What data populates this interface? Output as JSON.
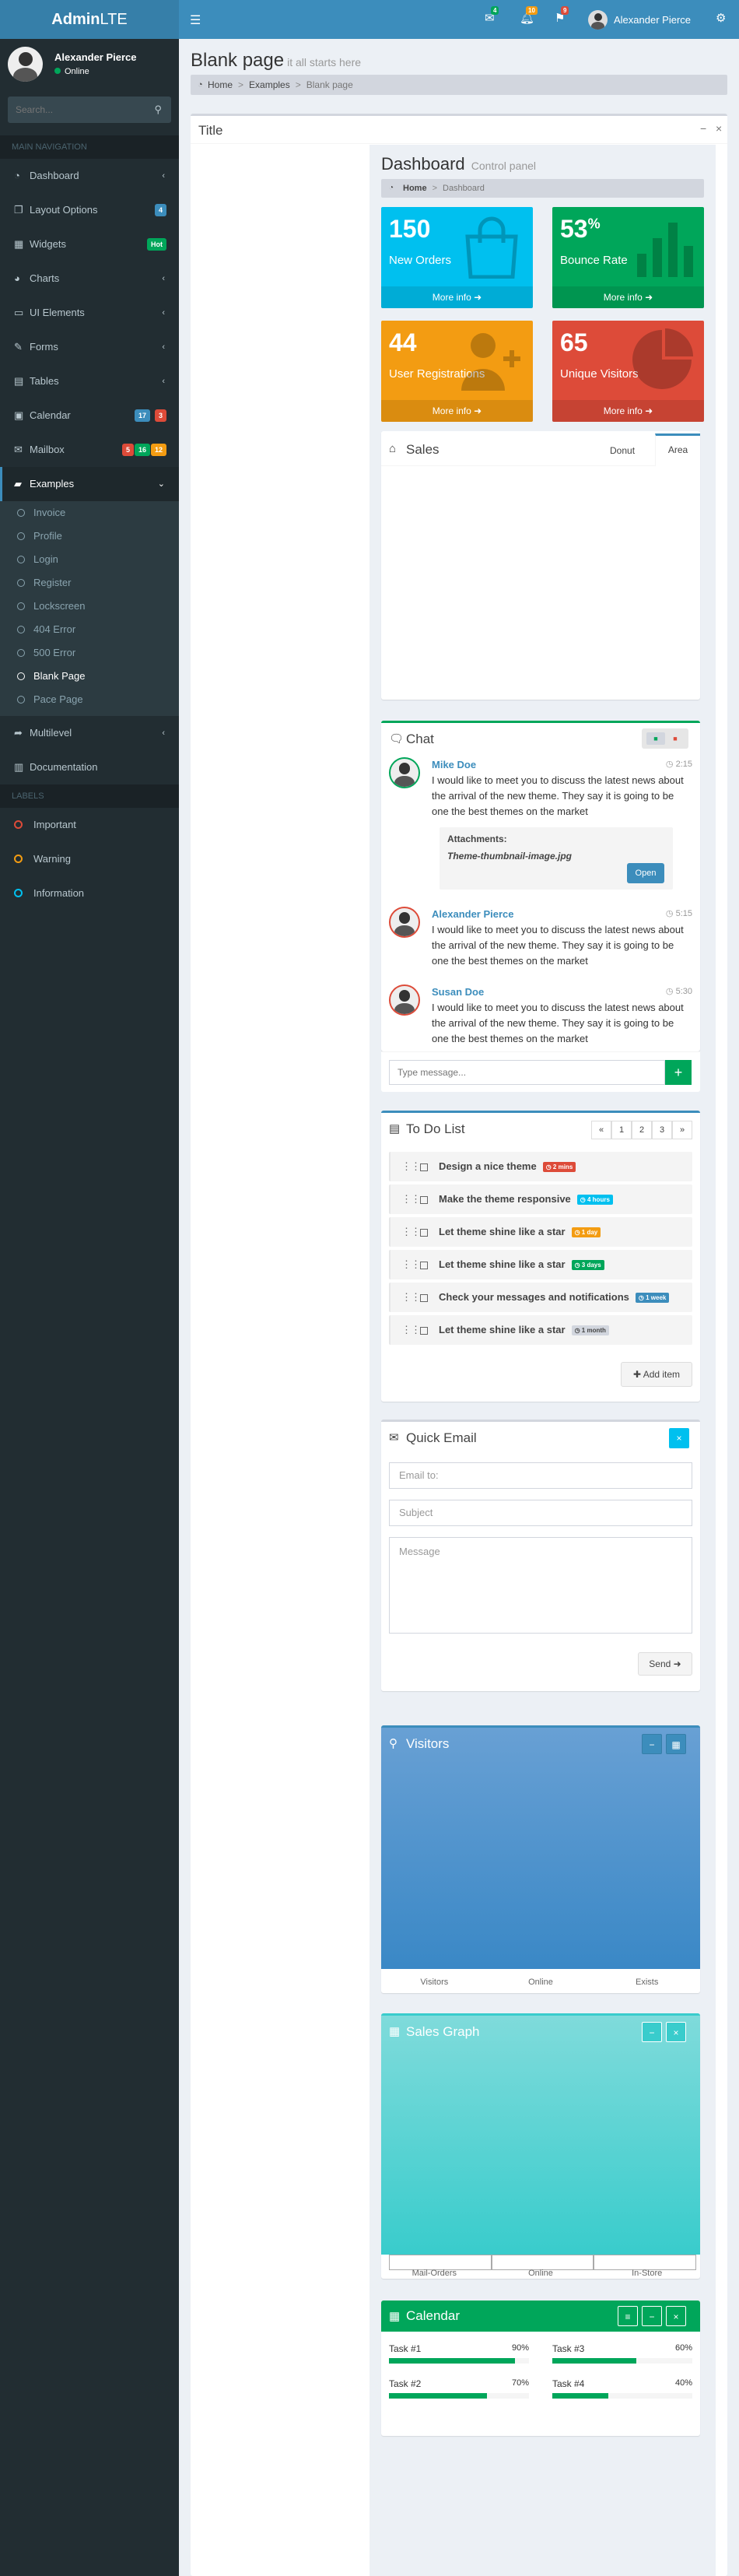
{
  "topbar": {
    "logo_bold": "Admin",
    "logo_light": "LTE",
    "toggle_icon": "hamburger-icon",
    "messages_count": "4",
    "notifications_count": "10",
    "tasks_count": "9",
    "user_name": "Alexander Pierce"
  },
  "sidebar": {
    "user_name": "Alexander Pierce",
    "user_status": "Online",
    "search_placeholder": "Search...",
    "main_header": "MAIN NAVIGATION",
    "items": [
      {
        "label": "Dashboard",
        "icon": "dashboard-icon"
      },
      {
        "label": "Layout Options",
        "icon": "files-icon",
        "badge": "4",
        "badge_color": "#3c8dbc"
      },
      {
        "label": "Widgets",
        "icon": "th-icon",
        "badge": "Hot",
        "badge_color": "#00a65a"
      },
      {
        "label": "Charts",
        "icon": "pie-chart-icon"
      },
      {
        "label": "UI Elements",
        "icon": "laptop-icon"
      },
      {
        "label": "Forms",
        "icon": "edit-icon"
      },
      {
        "label": "Tables",
        "icon": "table-icon"
      },
      {
        "label": "Calendar",
        "icon": "calendar-icon",
        "badges": [
          "17",
          "3"
        ]
      },
      {
        "label": "Mailbox",
        "icon": "envelope-icon",
        "badges": [
          "5",
          "16",
          "12"
        ]
      },
      {
        "label": "Examples",
        "icon": "folder-icon"
      },
      {
        "label": "Multilevel",
        "icon": "share-icon"
      },
      {
        "label": "Documentation",
        "icon": "book-icon"
      }
    ],
    "examples_sub": [
      "Invoice",
      "Profile",
      "Login",
      "Register",
      "Lockscreen",
      "404 Error",
      "500 Error",
      "Blank Page",
      "Pace Page"
    ],
    "labels_header": "LABELS",
    "labels": [
      {
        "label": "Important",
        "color": "#dd4b39"
      },
      {
        "label": "Warning",
        "color": "#f39c12"
      },
      {
        "label": "Information",
        "color": "#00c0ef"
      }
    ]
  },
  "page": {
    "title": "Blank page",
    "subtitle": "it all starts here",
    "breadcrumb": [
      "Home",
      "Examples",
      "Blank page"
    ],
    "box_title": "Title"
  },
  "dashboard": {
    "title": "Dashboard",
    "subtitle": "Control panel",
    "breadcrumb": [
      "Home",
      "Dashboard"
    ],
    "stat_boxes": [
      {
        "value": "150",
        "sup": "",
        "label": "New Orders",
        "footer": "More info",
        "color": "#00c0ef",
        "icon": "shopping-bag-icon"
      },
      {
        "value": "53",
        "sup": "%",
        "label": "Bounce Rate",
        "footer": "More info",
        "color": "#00a65a",
        "icon": "bar-chart-icon"
      },
      {
        "value": "44",
        "sup": "",
        "label": "User Registrations",
        "footer": "More info",
        "color": "#f39c12",
        "icon": "person-add-icon"
      },
      {
        "value": "65",
        "sup": "",
        "label": "Unique Visitors",
        "footer": "More info",
        "color": "#dd4b39",
        "icon": "pie-graph-icon"
      }
    ],
    "sales": {
      "title": "Sales",
      "tabs": [
        "Donut",
        "Area"
      ]
    },
    "chat": {
      "title": "Chat",
      "messages": [
        {
          "name": "Mike Doe",
          "time": "2:15",
          "text": "I would like to meet you to discuss the latest news about the arrival of the new theme. They say it is going to be one the best themes on the market"
        },
        {
          "name": "Alexander Pierce",
          "time": "5:15",
          "text": "I would like to meet you to discuss the latest news about the arrival of the new theme. They say it is going to be one the best themes on the market"
        },
        {
          "name": "Susan Doe",
          "time": "5:30",
          "text": "I would like to meet you to discuss the latest news about the arrival of the new theme. They say it is going to be one the best themes on the market"
        }
      ],
      "attachments_label": "Attachments:",
      "attachment_file": "Theme-thumbnail-image.jpg",
      "open_label": "Open",
      "input_placeholder": "Type message..."
    },
    "todo": {
      "title": "To Do List",
      "pages": [
        "«",
        "1",
        "2",
        "3",
        "»"
      ],
      "items": [
        {
          "text": "Design a nice theme",
          "badge": "2 mins",
          "color": "#dd4b39"
        },
        {
          "text": "Make the theme responsive",
          "badge": "4 hours",
          "color": "#00c0ef"
        },
        {
          "text": "Let theme shine like a star",
          "badge": "1 day",
          "color": "#f39c12"
        },
        {
          "text": "Let theme shine like a star",
          "badge": "3 days",
          "color": "#00a65a"
        },
        {
          "text": "Check your messages and notifications",
          "badge": "1 week",
          "color": "#3c8dbc"
        },
        {
          "text": "Let theme shine like a star",
          "badge": "1 month",
          "color": "#d2d6de"
        }
      ],
      "add_label": "Add item"
    },
    "email": {
      "title": "Quick Email",
      "to_placeholder": "Email to:",
      "subject_placeholder": "Subject",
      "message_placeholder": "Message",
      "send_label": "Send"
    },
    "visitors": {
      "title": "Visitors",
      "footer": [
        "Visitors",
        "Online",
        "Exists"
      ]
    },
    "sales_graph": {
      "title": "Sales Graph",
      "footer": [
        "Mail-Orders",
        "Online",
        "In-Store"
      ]
    },
    "calendar": {
      "title": "Calendar",
      "tasks": [
        {
          "name": "Task #1",
          "pct": "90%",
          "value": 90
        },
        {
          "name": "Task #3",
          "pct": "60%",
          "value": 60
        },
        {
          "name": "Task #2",
          "pct": "70%",
          "value": 70
        },
        {
          "name": "Task #4",
          "pct": "40%",
          "value": 40
        }
      ]
    }
  }
}
